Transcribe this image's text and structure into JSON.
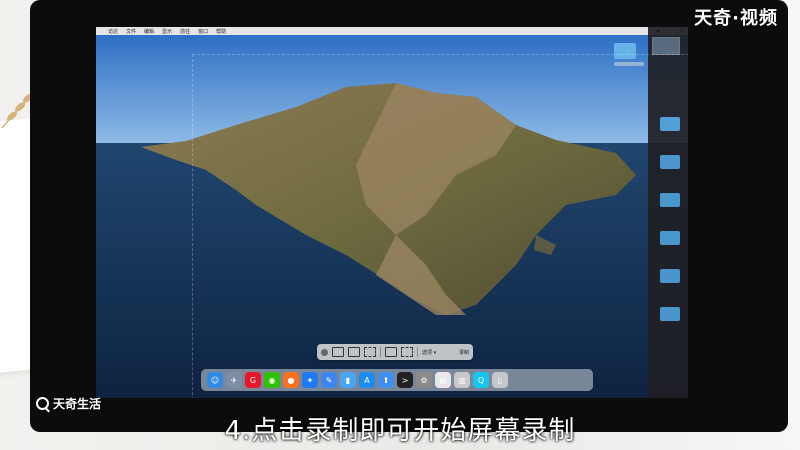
{
  "brand": {
    "logo_text": "天奇·视频"
  },
  "watermark": {
    "text": "天奇生活"
  },
  "caption": "4.点击录制即可开始屏幕录制",
  "menubar": {
    "apple": "",
    "items": [
      "访达",
      "文件",
      "编辑",
      "显示",
      "前往",
      "窗口",
      "帮助"
    ]
  },
  "toolbar": {
    "options_label": "选项 ▾",
    "record_label": "录制"
  },
  "dock_apps": [
    {
      "name": "finder-icon",
      "color": "#2f8ae5",
      "glyph": "☺"
    },
    {
      "name": "launchpad-icon",
      "color": "#7c8ea6",
      "glyph": "✈"
    },
    {
      "name": "weibo-icon",
      "color": "#e6162d",
      "glyph": "G"
    },
    {
      "name": "wechat-icon",
      "color": "#2dc100",
      "glyph": "◉"
    },
    {
      "name": "firefox-icon",
      "color": "#ff6f1f",
      "glyph": "●"
    },
    {
      "name": "safari-icon",
      "color": "#1e7cf2",
      "glyph": "✦"
    },
    {
      "name": "xcode-icon",
      "color": "#3e86ef",
      "glyph": "✎"
    },
    {
      "name": "notes-icon",
      "color": "#48a6f1",
      "glyph": "▮"
    },
    {
      "name": "app-store-icon",
      "color": "#1c8cf4",
      "glyph": "A"
    },
    {
      "name": "upload-icon",
      "color": "#3f8ef0",
      "glyph": "⬆"
    },
    {
      "name": "terminal-icon",
      "color": "#222222",
      "glyph": ">"
    },
    {
      "name": "system-preferences-icon",
      "color": "#8a8a8a",
      "glyph": "⚙"
    },
    {
      "name": "textedit-icon",
      "color": "#e8e8e8",
      "glyph": "▤"
    },
    {
      "name": "preview-icon",
      "color": "#c9c9c9",
      "glyph": "▥"
    },
    {
      "name": "quicktime-icon",
      "color": "#15c6f3",
      "glyph": "Q"
    },
    {
      "name": "trash-icon",
      "color": "#c5c7cc",
      "glyph": "▯"
    }
  ]
}
